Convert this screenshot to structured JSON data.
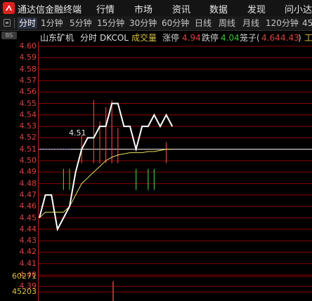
{
  "app": {
    "title": "通达信金融终端"
  },
  "menu": [
    "行情",
    "市场",
    "资讯",
    "数据",
    "发现",
    "问小达"
  ],
  "tabs": [
    "分时",
    "1分钟",
    "5分钟",
    "15分钟",
    "30分钟",
    "60分钟",
    "日线",
    "周线",
    "月线",
    "120分钟",
    "45"
  ],
  "info": {
    "badge": "BS",
    "stock_name": "山东矿机",
    "period": "分时",
    "indicator": "DKCOL",
    "volume_label": "成交量",
    "limit_up_label": "涨停",
    "limit_up_value": "4.94",
    "limit_down_label": "跌停",
    "limit_down_value": "4.04",
    "cage_label": "笼子(",
    "cage_low": "4.64",
    "cage_high": "4.43",
    "cage_close": ")",
    "trailing": "工"
  },
  "price_flag": "4.51",
  "colors": {
    "up": "#e04040",
    "down": "#40c040",
    "price": "#ffffff",
    "avg": "#e8e060",
    "grid": "#8b0000"
  },
  "chart_data": {
    "type": "line",
    "y_ticks": [
      "4.60",
      "4.59",
      "4.58",
      "4.57",
      "4.56",
      "4.55",
      "4.54",
      "4.53",
      "4.52",
      "4.51",
      "4.50",
      "4.49",
      "4.48",
      "4.47",
      "4.46",
      "4.45",
      "4.44",
      "4.43",
      "4.42",
      "4.41",
      "4.40",
      "4.39"
    ],
    "volume_ticks": [
      "60271",
      "45203"
    ],
    "ylim": [
      4.39,
      4.6
    ],
    "series": [
      {
        "values": [
          4.45,
          4.47,
          4.47,
          4.44,
          4.45,
          4.46,
          4.49,
          4.51,
          4.52,
          4.52,
          4.53,
          4.53,
          4.55,
          4.55,
          4.53,
          4.53,
          4.51,
          4.53,
          4.53,
          4.54,
          4.53,
          4.54,
          4.53
        ]
      },
      {
        "values": [
          4.45,
          4.455,
          4.455,
          4.455,
          4.455,
          4.46,
          4.47,
          4.48,
          4.485,
          4.49,
          4.495,
          4.5,
          4.503,
          4.505,
          4.506,
          4.507,
          4.507,
          4.507,
          4.508,
          4.508,
          4.509,
          4.51,
          4.51
        ]
      }
    ],
    "reference": 4.51,
    "bars_up": [
      0,
      0,
      0,
      0,
      0,
      0,
      0,
      0.4,
      0,
      0.9,
      0.6,
      0.8,
      0.9,
      0.5,
      0,
      0,
      0,
      0,
      0,
      0,
      0,
      0.3,
      0
    ],
    "bars_down": [
      0,
      0,
      0,
      0,
      0.4,
      0.4,
      0,
      0,
      0,
      0,
      0,
      0,
      0,
      0,
      0,
      0,
      0.4,
      0,
      0.4,
      0.4,
      0,
      0,
      0
    ]
  }
}
